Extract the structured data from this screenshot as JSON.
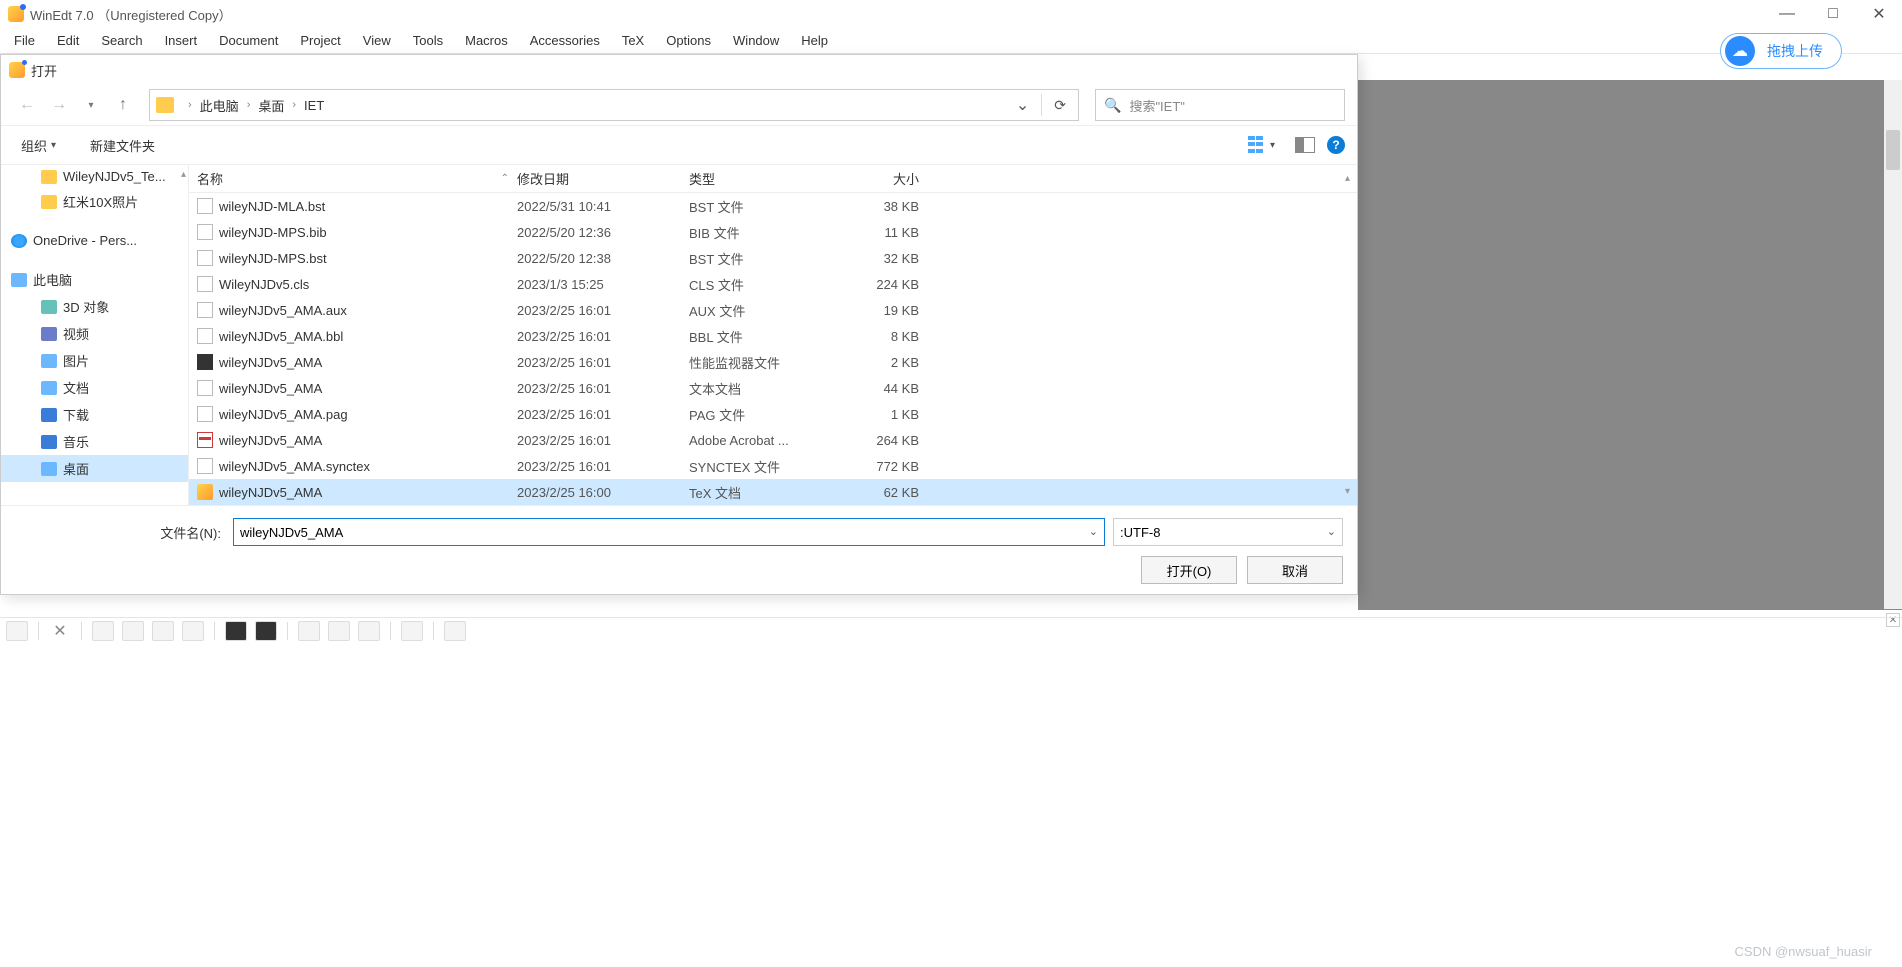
{
  "parentWindow": {
    "title": "WinEdt 7.0 （Unregistered Copy）",
    "menus": [
      "File",
      "Edit",
      "Search",
      "Insert",
      "Document",
      "Project",
      "View",
      "Tools",
      "Macros",
      "Accessories",
      "TeX",
      "Options",
      "Window",
      "Help"
    ],
    "uploadPill": "拖拽上传"
  },
  "dialog": {
    "title": "打开",
    "breadcrumb": [
      "此电脑",
      "桌面",
      "IET"
    ],
    "searchPlaceholder": "搜索\"IET\"",
    "toolbar": {
      "organize": "组织",
      "newFolder": "新建文件夹"
    },
    "columns": {
      "name": "名称",
      "date": "修改日期",
      "type": "类型",
      "size": "大小"
    },
    "navTree": [
      {
        "label": "WileyNJDv5_Te...",
        "icon": "folder",
        "indent": 1
      },
      {
        "label": "红米10X照片",
        "icon": "folder",
        "indent": 1
      },
      {
        "label": "OneDrive - Pers...",
        "icon": "onedrive",
        "indent": 0,
        "spaceBefore": true
      },
      {
        "label": "此电脑",
        "icon": "pc",
        "indent": 0,
        "spaceBefore": true
      },
      {
        "label": "3D 对象",
        "icon": "obj3d",
        "indent": 1
      },
      {
        "label": "视频",
        "icon": "video",
        "indent": 1
      },
      {
        "label": "图片",
        "icon": "pic",
        "indent": 1
      },
      {
        "label": "文档",
        "icon": "doc",
        "indent": 1
      },
      {
        "label": "下载",
        "icon": "down",
        "indent": 1
      },
      {
        "label": "音乐",
        "icon": "music",
        "indent": 1
      },
      {
        "label": "桌面",
        "icon": "desk",
        "indent": 1,
        "selected": true
      }
    ],
    "files": [
      {
        "name": "wileyNJD-MLA.bst",
        "date": "2022/5/31 10:41",
        "type": "BST 文件",
        "size": "38 KB",
        "icon": "file"
      },
      {
        "name": "wileyNJD-MPS.bib",
        "date": "2022/5/20 12:36",
        "type": "BIB 文件",
        "size": "11 KB",
        "icon": "file"
      },
      {
        "name": "wileyNJD-MPS.bst",
        "date": "2022/5/20 12:38",
        "type": "BST 文件",
        "size": "32 KB",
        "icon": "file"
      },
      {
        "name": "WileyNJDv5.cls",
        "date": "2023/1/3 15:25",
        "type": "CLS 文件",
        "size": "224 KB",
        "icon": "file"
      },
      {
        "name": "wileyNJDv5_AMA.aux",
        "date": "2023/2/25 16:01",
        "type": "AUX 文件",
        "size": "19 KB",
        "icon": "file"
      },
      {
        "name": "wileyNJDv5_AMA.bbl",
        "date": "2023/2/25 16:01",
        "type": "BBL 文件",
        "size": "8 KB",
        "icon": "file"
      },
      {
        "name": "wileyNJDv5_AMA",
        "date": "2023/2/25 16:01",
        "type": "性能监视器文件",
        "size": "2 KB",
        "icon": "perf"
      },
      {
        "name": "wileyNJDv5_AMA",
        "date": "2023/2/25 16:01",
        "type": "文本文档",
        "size": "44 KB",
        "icon": "file"
      },
      {
        "name": "wileyNJDv5_AMA.pag",
        "date": "2023/2/25 16:01",
        "type": "PAG 文件",
        "size": "1 KB",
        "icon": "file"
      },
      {
        "name": "wileyNJDv5_AMA",
        "date": "2023/2/25 16:01",
        "type": "Adobe Acrobat ...",
        "size": "264 KB",
        "icon": "pdf"
      },
      {
        "name": "wileyNJDv5_AMA.synctex",
        "date": "2023/2/25 16:01",
        "type": "SYNCTEX 文件",
        "size": "772 KB",
        "icon": "file"
      },
      {
        "name": "wileyNJDv5_AMA",
        "date": "2023/2/25 16:00",
        "type": "TeX 文档",
        "size": "62 KB",
        "icon": "tex",
        "selected": true
      }
    ],
    "filenameLabel": "文件名(N):",
    "filenameValue": "wileyNJDv5_AMA",
    "encoding": ":UTF-8",
    "openBtn": "打开(O)",
    "cancelBtn": "取消"
  },
  "watermark": "CSDN @nwsuaf_huasir"
}
